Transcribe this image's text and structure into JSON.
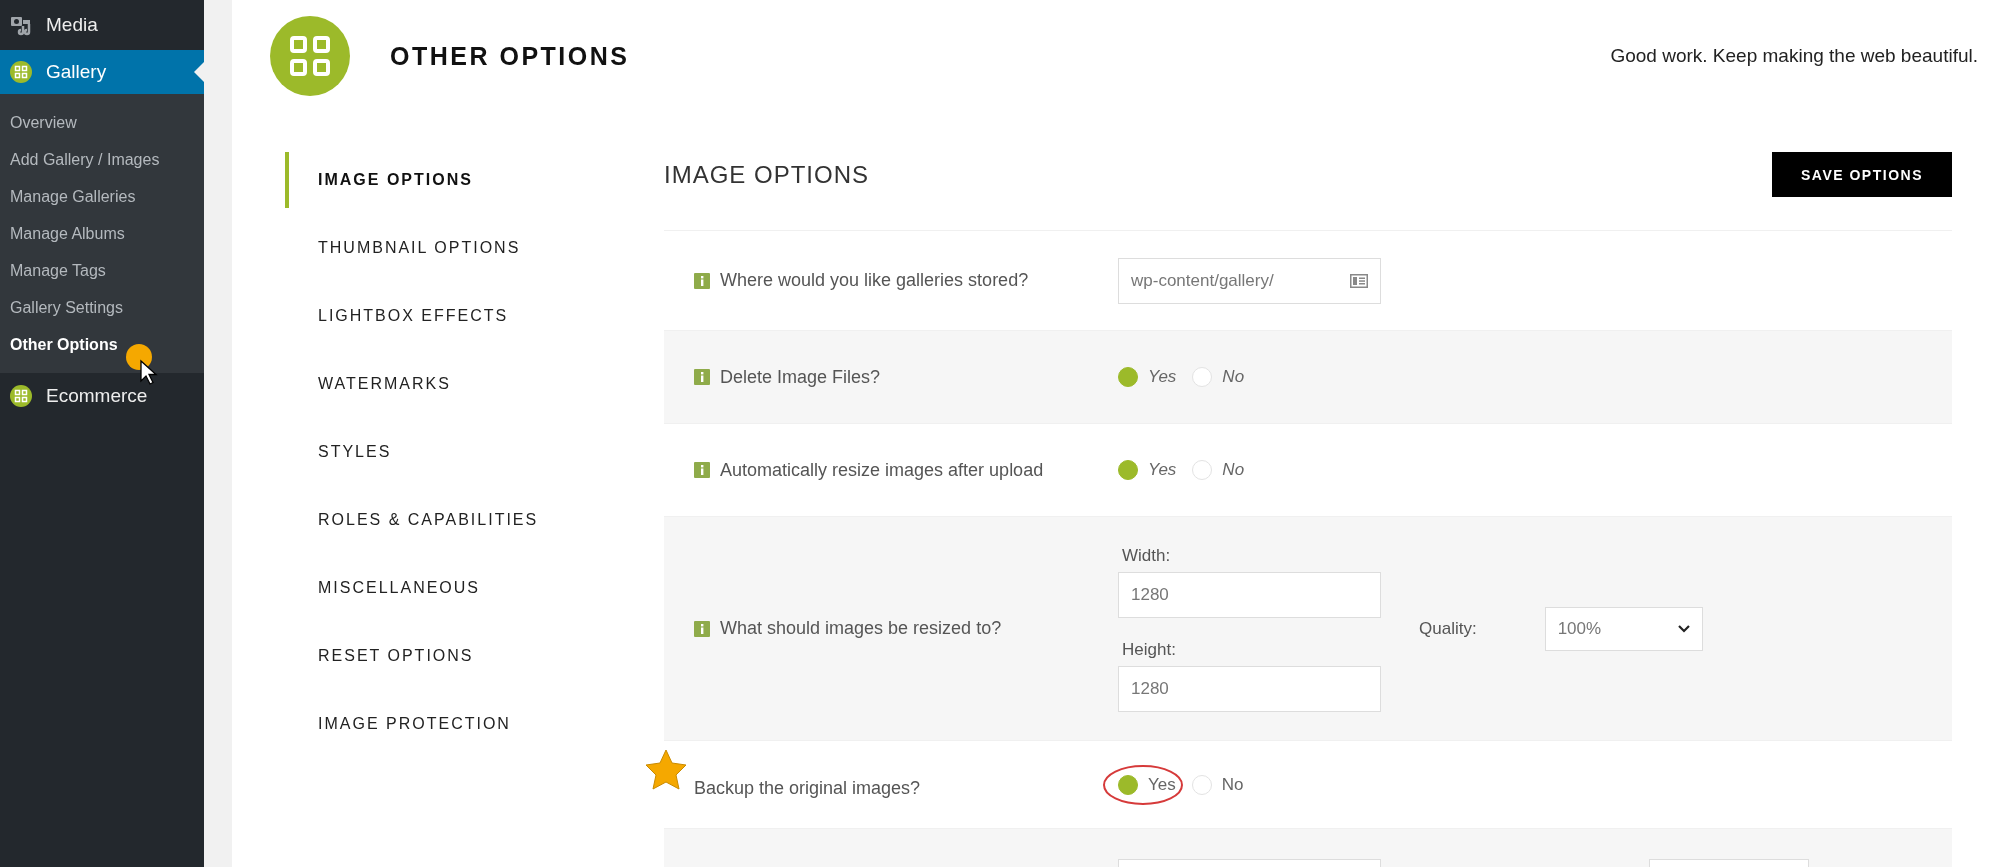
{
  "sidebar": {
    "items": [
      {
        "label": "Media",
        "selected": false
      },
      {
        "label": "Gallery",
        "selected": true,
        "children": [
          {
            "label": "Overview",
            "selected": false
          },
          {
            "label": "Add Gallery / Images",
            "selected": false
          },
          {
            "label": "Manage Galleries",
            "selected": false
          },
          {
            "label": "Manage Albums",
            "selected": false
          },
          {
            "label": "Manage Tags",
            "selected": false
          },
          {
            "label": "Gallery Settings",
            "selected": false
          },
          {
            "label": "Other Options",
            "selected": true
          }
        ]
      },
      {
        "label": "Ecommerce",
        "selected": false
      }
    ]
  },
  "header": {
    "title": "OTHER OPTIONS",
    "tagline": "Good work. Keep making the web beautiful."
  },
  "tabs": [
    {
      "label": "IMAGE OPTIONS",
      "selected": true
    },
    {
      "label": "THUMBNAIL OPTIONS",
      "selected": false
    },
    {
      "label": "LIGHTBOX EFFECTS",
      "selected": false
    },
    {
      "label": "WATERMARKS",
      "selected": false
    },
    {
      "label": "STYLES",
      "selected": false
    },
    {
      "label": "ROLES & CAPABILITIES",
      "selected": false
    },
    {
      "label": "MISCELLANEOUS",
      "selected": false
    },
    {
      "label": "RESET OPTIONS",
      "selected": false
    },
    {
      "label": "IMAGE PROTECTION",
      "selected": false
    }
  ],
  "section": {
    "title": "IMAGE OPTIONS",
    "save_button": "SAVE OPTIONS"
  },
  "rows": [
    {
      "kind": "text",
      "info": true,
      "annotated": false,
      "label": "Where would you like galleries stored?",
      "value": "wp-content/gallery/"
    },
    {
      "kind": "radio",
      "info": true,
      "annotated": false,
      "label": "Delete Image Files?",
      "options": [
        {
          "label": "Yes",
          "selected": true
        },
        {
          "label": "No",
          "selected": false
        }
      ]
    },
    {
      "kind": "radio",
      "info": true,
      "annotated": false,
      "label": "Automatically resize images after upload",
      "options": [
        {
          "label": "Yes",
          "selected": true
        },
        {
          "label": "No",
          "selected": false
        }
      ]
    },
    {
      "kind": "size",
      "info": true,
      "annotated": false,
      "label": "What should images be resized to?",
      "width_label": "Width:",
      "width_value": "1280",
      "height_label": "Height:",
      "height_value": "1280",
      "quality_label": "Quality:",
      "quality_value": "100%"
    },
    {
      "kind": "radio",
      "info": false,
      "annotated": true,
      "label": "Backup the original images?",
      "options": [
        {
          "label": "Yes",
          "selected": true
        },
        {
          "label": "No",
          "selected": false
        }
      ]
    },
    {
      "kind": "partial"
    }
  ]
}
